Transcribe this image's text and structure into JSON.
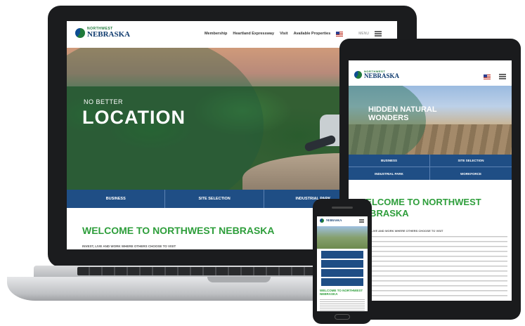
{
  "brand": {
    "logo_small": "NORTHWEST",
    "logo_big": "NEBRASKA"
  },
  "laptop": {
    "nav": [
      "Membership",
      "Heartland Expressway",
      "Visit",
      "Available Properties"
    ],
    "menu_label": "MENU",
    "hero_kicker": "NO BETTER",
    "hero_title": "LOCATION",
    "tabs": [
      "BUSINESS",
      "SITE SELECTION",
      "INDUSTRIAL PARK"
    ],
    "welcome": "WELCOME TO NORTHWEST NEBRASKA",
    "subline": "INVEST, LIVE AND WORK WHERE OTHERS CHOOSE TO VISIT"
  },
  "tablet": {
    "hero_line1": "HIDDEN NATURAL",
    "hero_line2": "WONDERS",
    "tabs": [
      "BUSINESS",
      "SITE SELECTION",
      "INDUSTRIAL PARK",
      "WORKFORCE"
    ],
    "welcome_line1": "WELCOME TO NORTHWEST",
    "welcome_line2": "NEBRASKA",
    "subline": "INVEST, LIVE AND WORK WHERE OTHERS CHOOSE TO VISIT"
  },
  "phone": {
    "welcome": "WELCOME TO NORTHWEST NEBRASKA"
  },
  "colors": {
    "brand_blue": "#1f4e85",
    "brand_green": "#2e9e3b"
  }
}
